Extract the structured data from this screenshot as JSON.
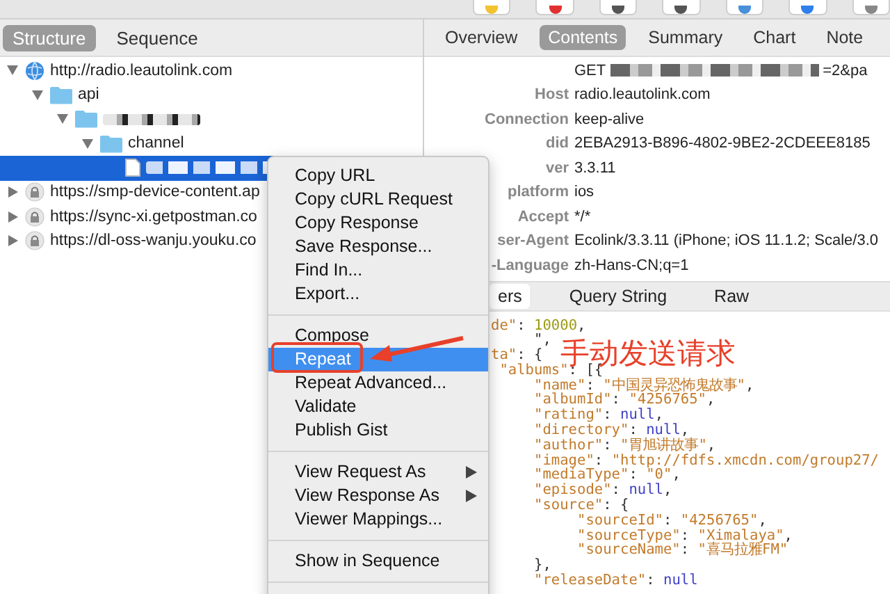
{
  "left_tabs": [
    {
      "label": "Structure",
      "selected": true
    },
    {
      "label": "Sequence",
      "selected": false
    }
  ],
  "tree": [
    {
      "label": "http://radio.leautolink.com",
      "kind": "globe",
      "expanded": true,
      "selected": false,
      "children": [
        {
          "label": "api",
          "kind": "folder",
          "expanded": true,
          "selected": false,
          "children": [
            {
              "kind": "folder",
              "expanded": true,
              "selected": false,
              "children": [
                {
                  "label": "channel",
                  "kind": "folder",
                  "expanded": true,
                  "selected": false,
                  "children": [
                    {
                      "kind": "file",
                      "selected": true
                    }
                  ]
                }
              ]
            }
          ]
        }
      ]
    },
    {
      "label": "https://smp-device-content.ap",
      "kind": "lock",
      "expanded": false,
      "selected": false
    },
    {
      "label": "https://sync-xi.getpostman.co",
      "kind": "lock",
      "expanded": false,
      "selected": false
    },
    {
      "label": "https://dl-oss-wanju.youku.co",
      "kind": "lock",
      "expanded": false,
      "selected": false
    }
  ],
  "right_tabs": [
    {
      "label": "Overview",
      "selected": false
    },
    {
      "label": "Contents",
      "selected": true
    },
    {
      "label": "Summary",
      "selected": false
    },
    {
      "label": "Chart",
      "selected": false
    },
    {
      "label": "Note",
      "selected": false
    }
  ],
  "request_headers": [
    {
      "value": "GET",
      "tail": "=2&pa"
    },
    {
      "key": "Host",
      "value": "radio.leautolink.com"
    },
    {
      "key": "Connection",
      "value": "keep-alive"
    },
    {
      "key": "did",
      "value": "2EBA2913-B896-4802-9BE2-2CDEEE8185"
    },
    {
      "key": "ver",
      "value": "3.3.11"
    },
    {
      "key": "platform",
      "value": "ios"
    },
    {
      "key": "Accept",
      "value": "*/*"
    },
    {
      "key": "ser-Agent",
      "value": "Ecolink/3.3.11 (iPhone; iOS 11.1.2; Scale/3.0"
    },
    {
      "key": "-Language",
      "value": "zh-Hans-CN;q=1"
    }
  ],
  "response_tabs": [
    {
      "label": "ers",
      "selected": true
    },
    {
      "label": "Query String",
      "selected": false
    },
    {
      "label": "Raw",
      "selected": false
    }
  ],
  "code_lines": [
    [
      {
        "kind": "key",
        "text": "de\""
      },
      {
        "kind": "punct",
        "text": ": "
      },
      {
        "kind": "num",
        "text": "10000"
      },
      {
        "kind": "punct",
        "text": ","
      }
    ],
    [
      {
        "kind": "punct",
        "text": "     \","
      }
    ],
    [
      {
        "kind": "key",
        "text": "ta\""
      },
      {
        "kind": "punct",
        "text": ": {"
      }
    ],
    [
      {
        "kind": "key",
        "text": " \"albums\""
      },
      {
        "kind": "punct",
        "text": ": [{"
      }
    ],
    [
      {
        "kind": "key",
        "text": "     \"name\""
      },
      {
        "kind": "punct",
        "text": ": "
      },
      {
        "kind": "str",
        "text": "\"中国灵异恐怖鬼故事\""
      },
      {
        "kind": "punct",
        "text": ","
      }
    ],
    [
      {
        "kind": "key",
        "text": "     \"albumId\""
      },
      {
        "kind": "punct",
        "text": ": "
      },
      {
        "kind": "str",
        "text": "\"4256765\""
      },
      {
        "kind": "punct",
        "text": ","
      }
    ],
    [
      {
        "kind": "key",
        "text": "     \"rating\""
      },
      {
        "kind": "punct",
        "text": ": "
      },
      {
        "kind": "null",
        "text": "null"
      },
      {
        "kind": "punct",
        "text": ","
      }
    ],
    [
      {
        "kind": "key",
        "text": "     \"directory\""
      },
      {
        "kind": "punct",
        "text": ": "
      },
      {
        "kind": "null",
        "text": "null"
      },
      {
        "kind": "punct",
        "text": ","
      }
    ],
    [
      {
        "kind": "key",
        "text": "     \"author\""
      },
      {
        "kind": "punct",
        "text": ": "
      },
      {
        "kind": "str",
        "text": "\"胃旭讲故事\""
      },
      {
        "kind": "punct",
        "text": ","
      }
    ],
    [
      {
        "kind": "key",
        "text": "     \"image\""
      },
      {
        "kind": "punct",
        "text": ": "
      },
      {
        "kind": "str",
        "text": "\"http://fdfs.xmcdn.com/group27/"
      }
    ],
    [
      {
        "kind": "key",
        "text": "     \"mediaType\""
      },
      {
        "kind": "punct",
        "text": ": "
      },
      {
        "kind": "str",
        "text": "\"0\""
      },
      {
        "kind": "punct",
        "text": ","
      }
    ],
    [
      {
        "kind": "key",
        "text": "     \"episode\""
      },
      {
        "kind": "punct",
        "text": ": "
      },
      {
        "kind": "null",
        "text": "null"
      },
      {
        "kind": "punct",
        "text": ","
      }
    ],
    [
      {
        "kind": "key",
        "text": "     \"source\""
      },
      {
        "kind": "punct",
        "text": ": {"
      }
    ],
    [
      {
        "kind": "key",
        "text": "          \"sourceId\""
      },
      {
        "kind": "punct",
        "text": ": "
      },
      {
        "kind": "str",
        "text": "\"4256765\""
      },
      {
        "kind": "punct",
        "text": ","
      }
    ],
    [
      {
        "kind": "key",
        "text": "          \"sourceType\""
      },
      {
        "kind": "punct",
        "text": ": "
      },
      {
        "kind": "str",
        "text": "\"Ximalaya\""
      },
      {
        "kind": "punct",
        "text": ","
      }
    ],
    [
      {
        "kind": "key",
        "text": "          \"sourceName\""
      },
      {
        "kind": "punct",
        "text": ": "
      },
      {
        "kind": "str",
        "text": "\"喜马拉雅FM\""
      }
    ],
    [
      {
        "kind": "punct",
        "text": "     },"
      }
    ],
    [
      {
        "kind": "key",
        "text": "     \"releaseDate\""
      },
      {
        "kind": "punct",
        "text": ": "
      },
      {
        "kind": "null",
        "text": "null"
      }
    ]
  ],
  "context_menu": [
    {
      "kind": "item",
      "label": "Copy URL",
      "selected": false,
      "submenu": false
    },
    {
      "kind": "item",
      "label": "Copy cURL Request",
      "selected": false,
      "submenu": false
    },
    {
      "kind": "item",
      "label": "Copy Response",
      "selected": false,
      "submenu": false
    },
    {
      "kind": "item",
      "label": "Save Response...",
      "selected": false,
      "submenu": false
    },
    {
      "kind": "item",
      "label": "Find In...",
      "selected": false,
      "submenu": false
    },
    {
      "kind": "item",
      "label": "Export...",
      "selected": false,
      "submenu": false
    },
    {
      "kind": "separator"
    },
    {
      "kind": "item",
      "label": "Compose",
      "selected": false,
      "submenu": false
    },
    {
      "kind": "item",
      "label": "Repeat",
      "selected": true,
      "submenu": false
    },
    {
      "kind": "item",
      "label": "Repeat Advanced...",
      "selected": false,
      "submenu": false
    },
    {
      "kind": "item",
      "label": "Validate",
      "selected": false,
      "submenu": false
    },
    {
      "kind": "item",
      "label": "Publish Gist",
      "selected": false,
      "submenu": false
    },
    {
      "kind": "separator"
    },
    {
      "kind": "item",
      "label": "View Request As",
      "selected": false,
      "submenu": true
    },
    {
      "kind": "item",
      "label": "View Response As",
      "selected": false,
      "submenu": true
    },
    {
      "kind": "item",
      "label": "Viewer Mappings...",
      "selected": false,
      "submenu": false
    },
    {
      "kind": "separator"
    },
    {
      "kind": "item",
      "label": "Show in Sequence",
      "selected": false,
      "submenu": false
    },
    {
      "kind": "separator"
    }
  ],
  "annotation": {
    "text": "手动发送请求"
  }
}
